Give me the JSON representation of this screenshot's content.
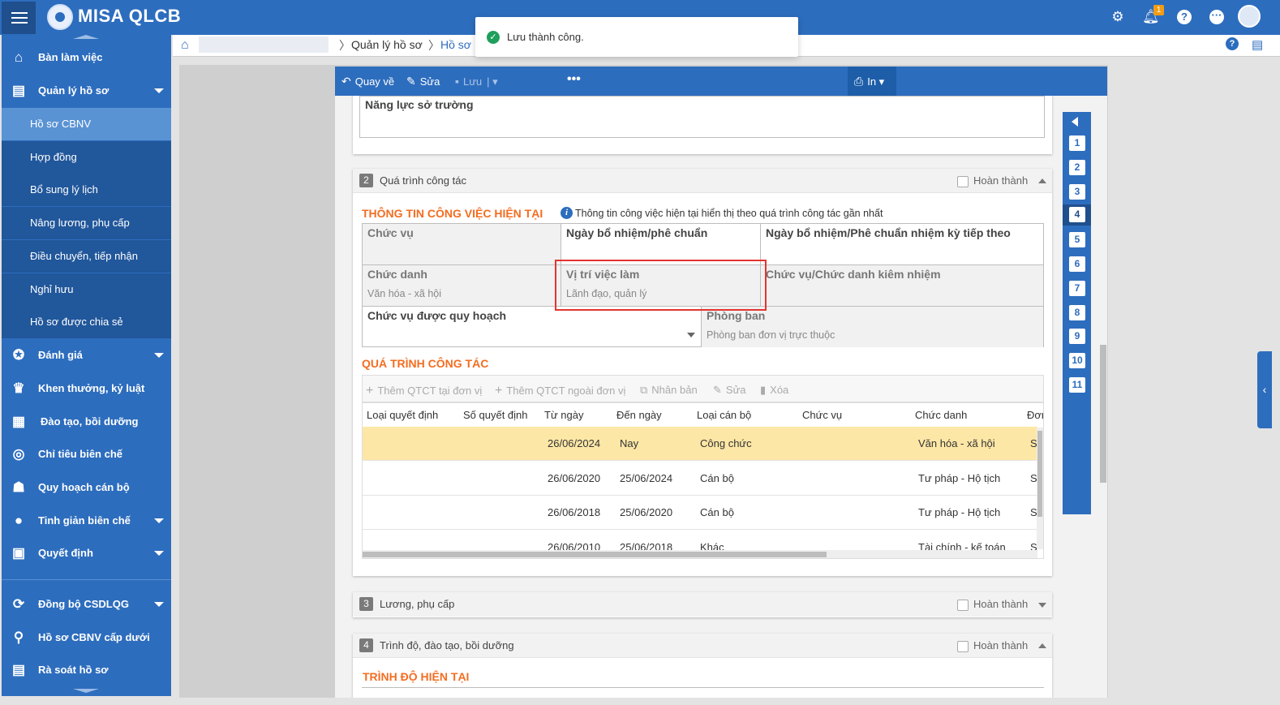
{
  "app": {
    "brand": "MISA QLCB",
    "notification_count": "1",
    "icons": [
      "hamburger-icon",
      "settings-icon",
      "bell-icon",
      "help-icon",
      "more-icon",
      "avatar"
    ]
  },
  "breadcrumb": {
    "items": [
      "Quản lý hồ sơ",
      "Hồ sơ"
    ]
  },
  "toast": {
    "message": "Lưu thành công."
  },
  "sidebar": {
    "items": [
      {
        "label": "Bàn làm việc",
        "icon": "home-icon"
      },
      {
        "label": "Quản lý hồ sơ",
        "icon": "id-card-icon"
      },
      {
        "label": "Đánh giá",
        "icon": "medal-icon"
      },
      {
        "label": "Khen thưởng, kỷ luật",
        "icon": "trophy-icon"
      },
      {
        "label": "Đào tạo, bồi dưỡng",
        "icon": "training-icon"
      },
      {
        "label": "Chỉ tiêu biên chế",
        "icon": "target-icon"
      },
      {
        "label": "Quy hoạch cán bộ",
        "icon": "people-icon"
      },
      {
        "label": "Tinh giản biên chế",
        "icon": "dots-icon"
      },
      {
        "label": "Quyết định",
        "icon": "clipboard-icon"
      },
      {
        "label": "Đồng bộ CSDLQG",
        "icon": "sync-icon"
      },
      {
        "label": "Hồ sơ CBNV cấp dưới",
        "icon": "search-icon"
      },
      {
        "label": "Rà soát hồ sơ",
        "icon": "document-icon"
      }
    ],
    "sub_items": [
      "Hồ sơ CBNV",
      "Hợp đồng",
      "Bổ sung lý lịch",
      "Nâng lương, phụ cấp",
      "Điều chuyển, tiếp nhận",
      "Nghỉ hưu",
      "Hồ sơ được chia sẻ"
    ]
  },
  "toolbar": {
    "back": "Quay về",
    "edit": "Sửa",
    "save": "Lưu",
    "print": "In"
  },
  "card1": {
    "field_label": "Năng lực sở trường"
  },
  "card2": {
    "num": "2",
    "title": "Quá trình công tác",
    "done": "Hoàn thành",
    "current_title": "THÔNG TIN CÔNG VIỆC HIỆN TẠI",
    "info_note": "Thông tin công việc hiện tại hiển thị theo quá trình công tác gần nhất",
    "fields": {
      "chuc_vu": {
        "label": "Chức vụ",
        "value": ""
      },
      "ngay_bn": {
        "label": "Ngày bổ nhiệm/phê chuẩn",
        "value": ""
      },
      "ngay_bn_next": {
        "label": "Ngày bổ nhiệm/Phê chuẩn nhiệm kỳ tiếp theo",
        "value": ""
      },
      "chuc_danh": {
        "label": "Chức danh",
        "value": "Văn hóa - xã hội"
      },
      "vi_tri": {
        "label": "Vị trí việc làm",
        "value": "Lãnh đạo, quản lý"
      },
      "kiem_nhiem": {
        "label": "Chức vụ/Chức danh kiêm nhiệm",
        "value": ""
      },
      "quy_hoach": {
        "label": "Chức vụ được quy hoạch",
        "value": ""
      },
      "phong_ban": {
        "label": "Phòng ban",
        "value": "Phòng ban đơn vị trực thuộc"
      }
    },
    "history_title": "QUÁ TRÌNH CÔNG TÁC",
    "history_toolbar": [
      "Thêm QTCT tại đơn vị",
      "Thêm QTCT ngoài đơn vị",
      "Nhân bản",
      "Sửa",
      "Xóa"
    ],
    "columns": [
      "Loại quyết định",
      "Số quyết định",
      "Từ ngày",
      "Đến ngày",
      "Loại cán bộ",
      "Chức vụ",
      "Chức danh",
      "Đơn"
    ],
    "rows": [
      {
        "loai_qd": "",
        "so_qd": "",
        "tu_ngay": "26/06/2024",
        "den_ngay": "Nay",
        "loai_cb": "Công chức",
        "chuc_vu": "",
        "chuc_danh": "Văn hóa - xã hội",
        "don": "S"
      },
      {
        "loai_qd": "",
        "so_qd": "",
        "tu_ngay": "26/06/2020",
        "den_ngay": "25/06/2024",
        "loai_cb": "Cán bộ",
        "chuc_vu": "",
        "chuc_danh": "Tư pháp - Hộ tịch",
        "don": "S"
      },
      {
        "loai_qd": "",
        "so_qd": "",
        "tu_ngay": "26/06/2018",
        "den_ngay": "25/06/2020",
        "loai_cb": "Cán bộ",
        "chuc_vu": "",
        "chuc_danh": "Tư pháp - Hộ tịch",
        "don": "S"
      },
      {
        "loai_qd": "",
        "so_qd": "",
        "tu_ngay": "26/06/2010",
        "den_ngay": "25/06/2018",
        "loai_cb": "Khác",
        "chuc_vu": "",
        "chuc_danh": "Tài chính - kế toán",
        "don": "S"
      }
    ]
  },
  "card3": {
    "num": "3",
    "title": "Lương, phụ cấp",
    "done": "Hoàn thành"
  },
  "card4": {
    "num": "4",
    "title": "Trình độ, đào tạo, bồi dưỡng",
    "done": "Hoàn thành",
    "section": "TRÌNH ĐỘ HIỆN TẠI"
  },
  "nav": {
    "numbers": [
      "1",
      "2",
      "3",
      "4",
      "5",
      "6",
      "7",
      "8",
      "9",
      "10",
      "11"
    ],
    "active": "4"
  },
  "colors": {
    "primary": "#2d6dbe",
    "dark": "#1f4f8c",
    "accent_orange": "#f36d21",
    "highlight_row": "#fde7a6",
    "highlight_box": "#e3342f",
    "success": "#1fa05a"
  }
}
